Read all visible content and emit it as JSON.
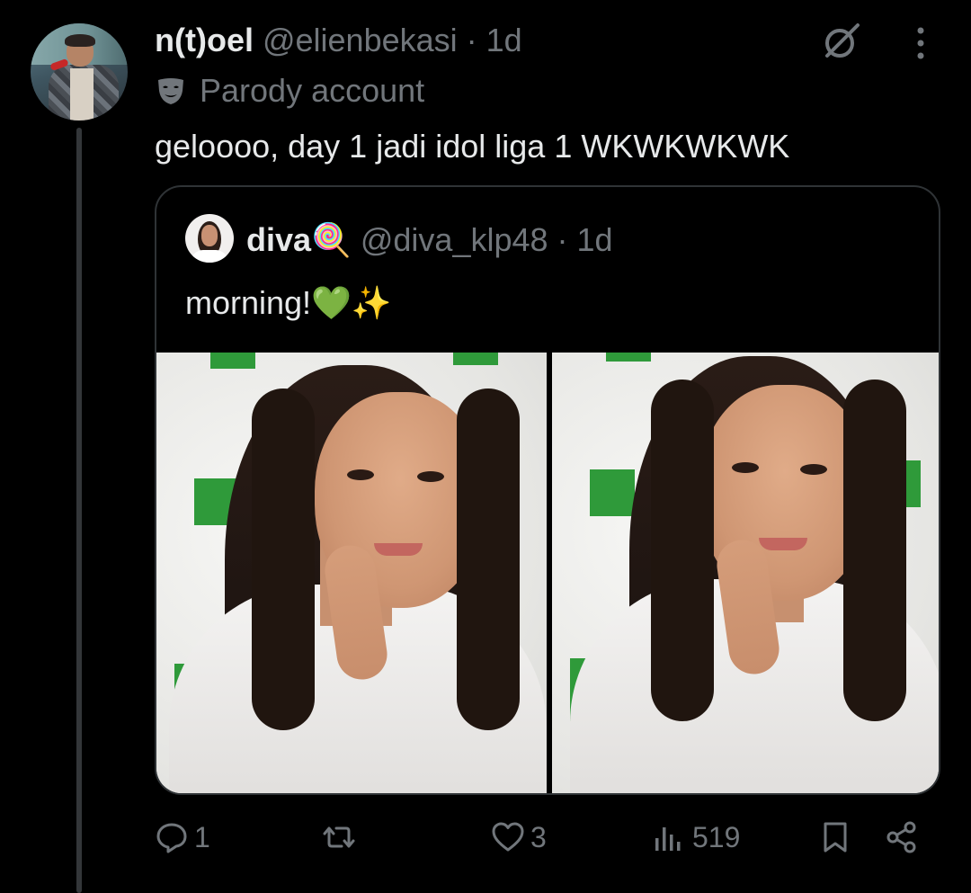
{
  "post": {
    "display_name": "n(t)oel",
    "handle": "@elienbekasi",
    "separator": "·",
    "time": "1d",
    "label": "Parody account",
    "text": "geloooo, day 1 jadi idol liga 1 WKWKWKWK"
  },
  "quote": {
    "display_name": "diva🍭",
    "handle": "@diva_klp48",
    "separator": "·",
    "time": "1d",
    "text": "morning!💚✨",
    "media": [
      {
        "type": "photo"
      },
      {
        "type": "photo"
      }
    ]
  },
  "actions": {
    "replies": "1",
    "reposts": "",
    "likes": "3",
    "views": "519"
  },
  "icons": [
    "parody-mask-icon",
    "grok-icon",
    "more-icon",
    "reply-icon",
    "repost-icon",
    "like-icon",
    "views-icon",
    "bookmark-icon",
    "share-icon"
  ],
  "colors": {
    "background": "#000000",
    "primary_text": "#e7e9ea",
    "secondary_text": "#71767b",
    "border": "#2f3336",
    "brand_green": "#2f9a3a"
  }
}
